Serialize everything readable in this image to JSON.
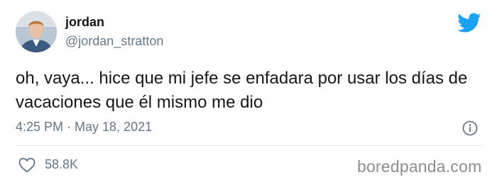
{
  "user": {
    "display_name": "jordan",
    "handle": "@jordan_stratton"
  },
  "tweet": {
    "text": "oh, vaya... hice que mi jefe se enfadara por usar los días de vacaciones que él mismo me dio",
    "timestamp": "4:25 PM · May 18, 2021",
    "likes": "58.8K"
  },
  "icons": {
    "brand": "twitter-bird-icon",
    "info": "info-icon",
    "like": "heart-icon"
  },
  "watermark": "boredpanda.com",
  "colors": {
    "twitter_blue": "#1da1f2",
    "text": "#14171a",
    "secondary": "#657786",
    "watermark": "#8d8d8d"
  }
}
